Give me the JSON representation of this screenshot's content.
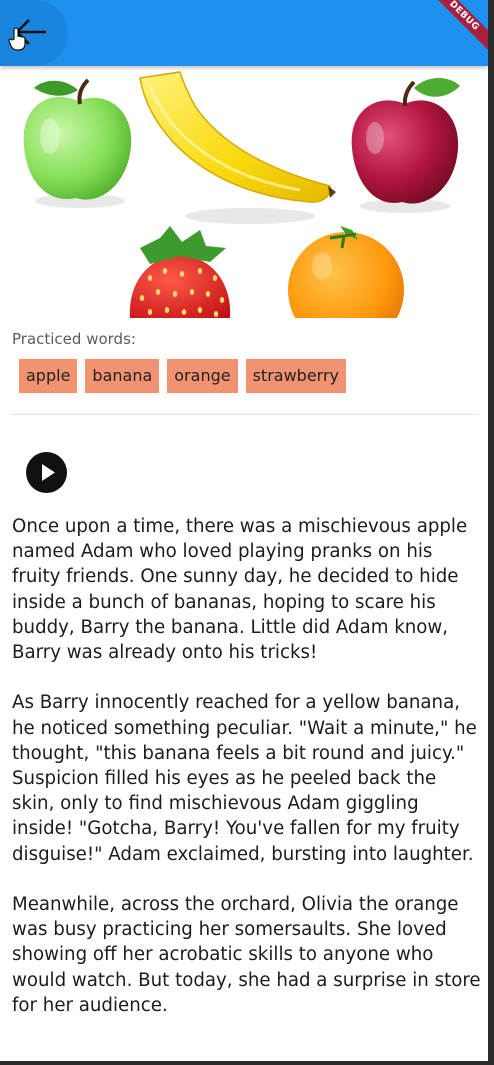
{
  "debug_banner": {
    "label": "DEBUG"
  },
  "hero_image": {
    "subject": "fruits: apple, banana, red apple, strawberry, orange"
  },
  "practiced": {
    "label": "Practiced words:",
    "words": [
      "apple",
      "banana",
      "orange",
      "strawberry"
    ]
  },
  "icons": {
    "back": "arrow-left-icon",
    "play": "play-icon"
  },
  "colors": {
    "appbar": "#1e90f0",
    "chip": "#f19370",
    "debug": "#a8213c"
  },
  "story": {
    "paragraphs": [
      "Once upon a time, there was a mischievous apple named Adam who loved playing pranks on his fruity friends. One sunny day, he decided to hide inside a bunch of bananas, hoping to scare his buddy, Barry the banana. Little did Adam know, Barry was already onto his tricks!",
      "As Barry innocently reached for a yellow banana, he noticed something peculiar. \"Wait a minute,\" he thought, \"this banana feels a bit round and juicy.\" Suspicion filled his eyes as he peeled back the skin, only to find mischievous Adam giggling inside! \"Gotcha, Barry! You've fallen for my fruity disguise!\" Adam exclaimed, bursting into laughter.",
      "Meanwhile, across the orchard, Olivia the orange was busy practicing her somersaults. She loved showing off her acrobatic skills to anyone who would watch. But today, she had a surprise in store for her audience."
    ]
  }
}
